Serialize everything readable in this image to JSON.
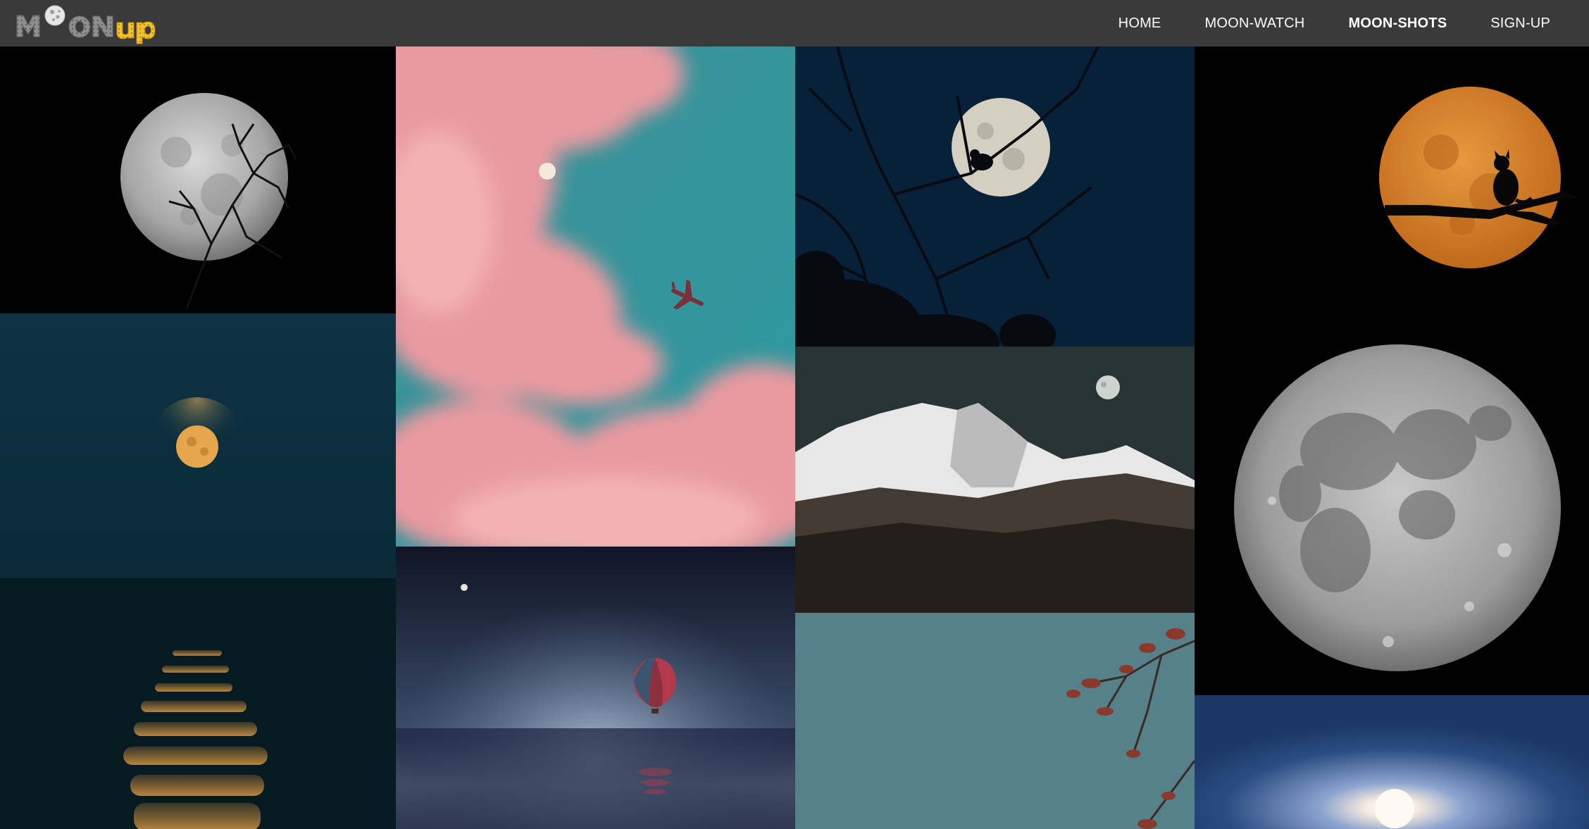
{
  "brand": {
    "logo_text_moon": "MOON",
    "logo_text_up": "up",
    "logo_alt": "MOONup"
  },
  "nav": {
    "items": [
      {
        "label": "HOME",
        "active": false
      },
      {
        "label": "MOON-WATCH",
        "active": false
      },
      {
        "label": "MOON-SHOTS",
        "active": true
      },
      {
        "label": "SIGN-UP",
        "active": false
      }
    ]
  },
  "gallery": {
    "photos": [
      {
        "name": "full-moon-with-branch"
      },
      {
        "name": "moon-over-sea-reflection"
      },
      {
        "name": "pink-clouds-airplane-moon"
      },
      {
        "name": "hot-air-balloon-over-water"
      },
      {
        "name": "bird-on-branch-moon"
      },
      {
        "name": "moon-over-snowy-mountain"
      },
      {
        "name": "branch-against-teal-sky"
      },
      {
        "name": "orange-moon-cat-silhouette"
      },
      {
        "name": "detailed-gray-moon"
      },
      {
        "name": "bright-moon-blue-sky"
      }
    ]
  },
  "colors": {
    "topbar": "#3a3a3a",
    "logo_gray": "#9a9a9a",
    "logo_yellow": "#f2c12e"
  }
}
